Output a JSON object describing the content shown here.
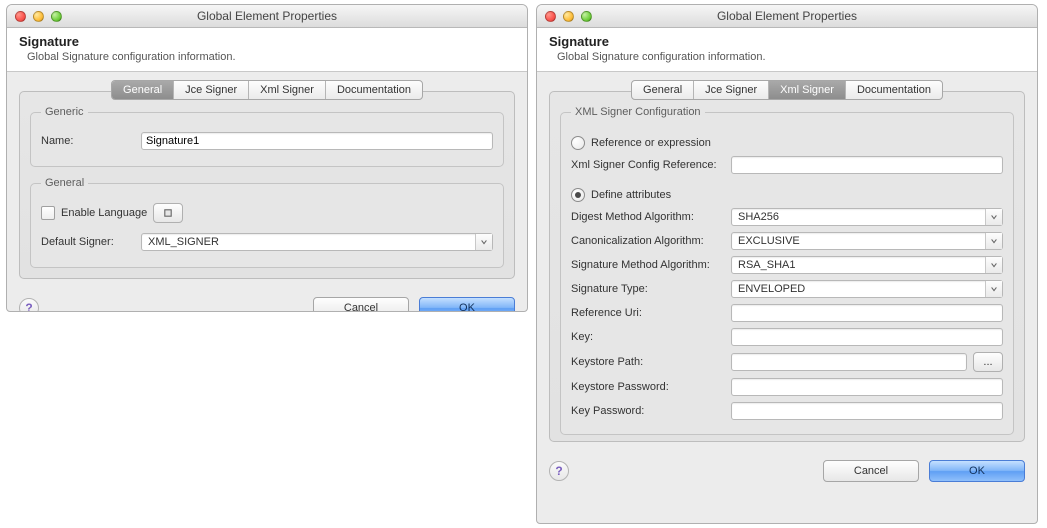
{
  "left": {
    "window_title": "Global Element Properties",
    "header_title": "Signature",
    "header_subtitle": "Global Signature configuration information.",
    "tabs": [
      "General",
      "Jce Signer",
      "Xml Signer",
      "Documentation"
    ],
    "active_tab_index": 0,
    "group_generic_legend": "Generic",
    "name_label": "Name:",
    "name_value": "Signature1",
    "group_general_legend": "General",
    "enable_language_label": "Enable Language",
    "enable_language_checked": false,
    "default_signer_label": "Default Signer:",
    "default_signer_value": "XML_SIGNER",
    "cancel_label": "Cancel",
    "ok_label": "OK"
  },
  "right": {
    "window_title": "Global Element Properties",
    "header_title": "Signature",
    "header_subtitle": "Global Signature configuration information.",
    "tabs": [
      "General",
      "Jce Signer",
      "Xml Signer",
      "Documentation"
    ],
    "active_tab_index": 2,
    "group_legend": "XML Signer Configuration",
    "radio_reference_label": "Reference or expression",
    "config_ref_label": "Xml Signer Config Reference:",
    "config_ref_value": "",
    "radio_define_label": "Define attributes",
    "selected_radio": "define",
    "fields": {
      "digest_label": "Digest Method Algorithm:",
      "digest_value": "SHA256",
      "canon_label": "Canonicalization Algorithm:",
      "canon_value": "EXCLUSIVE",
      "sigmethod_label": "Signature Method Algorithm:",
      "sigmethod_value": "RSA_SHA1",
      "sigtype_label": "Signature Type:",
      "sigtype_value": "ENVELOPED",
      "refuri_label": "Reference Uri:",
      "refuri_value": "",
      "key_label": "Key:",
      "key_value": "",
      "keystore_path_label": "Keystore Path:",
      "keystore_path_value": "",
      "keystore_browse_label": "...",
      "keystore_pass_label": "Keystore Password:",
      "keystore_pass_value": "",
      "key_pass_label": "Key Password:",
      "key_pass_value": ""
    },
    "cancel_label": "Cancel",
    "ok_label": "OK"
  }
}
